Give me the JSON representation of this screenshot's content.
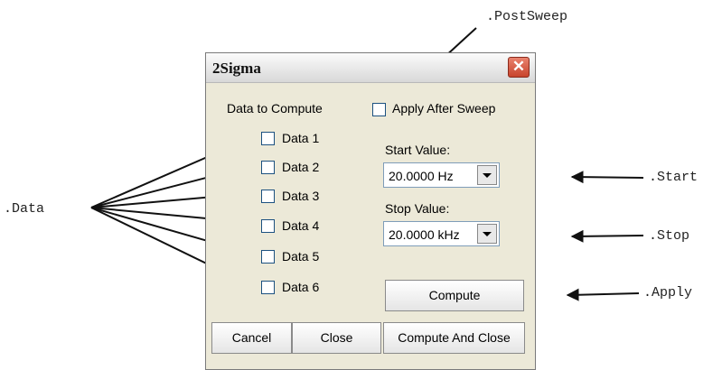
{
  "callouts": {
    "post_sweep": ".PostSweep",
    "data": ".Data",
    "start": ".Start",
    "stop": ".Stop",
    "apply": ".Apply"
  },
  "window": {
    "title": "2Sigma",
    "close_icon": "close-icon",
    "data_to_compute_label": "Data to Compute",
    "apply_after_sweep_label": "Apply After Sweep",
    "data_items": [
      {
        "label": "Data 1",
        "checked": false
      },
      {
        "label": "Data 2",
        "checked": false
      },
      {
        "label": "Data 3",
        "checked": false
      },
      {
        "label": "Data 4",
        "checked": false
      },
      {
        "label": "Data 5",
        "checked": false
      },
      {
        "label": "Data 6",
        "checked": false
      }
    ],
    "start_value_label": "Start Value:",
    "start_value": "20.0000  Hz",
    "stop_value_label": "Stop Value:",
    "stop_value": "20.0000 kHz",
    "compute_label": "Compute",
    "cancel_label": "Cancel",
    "close_label": "Close",
    "compute_and_close_label": "Compute And Close"
  }
}
